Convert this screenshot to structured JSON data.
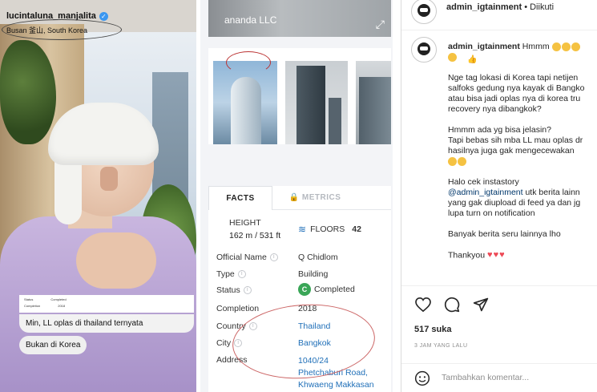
{
  "left_post": {
    "username": "lucintaluna_manjalita",
    "location": "Busan 釜山, South Korea",
    "mini_card": {
      "row1_label": "Status",
      "row1_value": "Completed",
      "row2_label": "Completion",
      "row2_value": "2018"
    },
    "caption_1": "Min, LL oplas di thailand ternyata",
    "caption_2": "Bukan di Korea"
  },
  "building": {
    "hero_watermark": "ananda LLC",
    "tabs": [
      {
        "label": "FACTS",
        "active": true
      },
      {
        "label": "METRICS",
        "active": false
      }
    ],
    "height_label": "HEIGHT",
    "height_value": "162 m / 531 ft",
    "floors_label": "FLOORS",
    "floors_value": "42",
    "facts": [
      {
        "label": "Official Name",
        "value": "Q Chidlom",
        "info": true,
        "link": false
      },
      {
        "label": "Type",
        "value": "Building",
        "info": true,
        "link": false
      },
      {
        "label": "Status",
        "value": "Completed",
        "info": true,
        "link": false,
        "badge": "C"
      },
      {
        "label": "Completion",
        "value": "2018",
        "info": false,
        "link": false
      },
      {
        "label": "Country",
        "value": "Thailand",
        "info": true,
        "link": true
      },
      {
        "label": "City",
        "value": "Bangkok",
        "info": true,
        "link": true
      }
    ],
    "address_label": "Address",
    "address_lines": [
      "1040/24",
      "Phetchaburi Road,",
      "Khwaeng Makkasan"
    ]
  },
  "instagram": {
    "header_username": "admin_igtainment",
    "header_separator": "•",
    "header_follow": "Diikuti",
    "comment_username": "admin_igtainment",
    "comment_first": "Hmmm",
    "paragraphs": [
      "Nge tag lokasi di Korea tapi netijen\nsalfoks gedung nya kayak di Bangko\natau bisa jadi oplas nya di korea tru\nrecovery nya dibangkok?",
      "Hmmm ada yg bisa jelasin?\nTapi bebas sih mba LL mau oplas dr\nhasilnya juga gak mengecewakan"
    ],
    "promo_line1": "Halo cek instastory",
    "promo_mention": "@admin_igtainment",
    "promo_rest": " utk berita lainn\nyang gak diupload di feed ya dan jg\nlupa turn on notification",
    "more_news": "Banyak berita seru lainnya lho",
    "thanks": "Thankyou",
    "likes": "517 suka",
    "time": "3 JAM YANG LALU",
    "comment_placeholder": "Tambahkan komentar...",
    "icons": [
      "heart-icon",
      "comment-icon",
      "share-icon",
      "emoji-icon"
    ],
    "accent_link": "#00376b",
    "heart_color": "#ed4956"
  }
}
